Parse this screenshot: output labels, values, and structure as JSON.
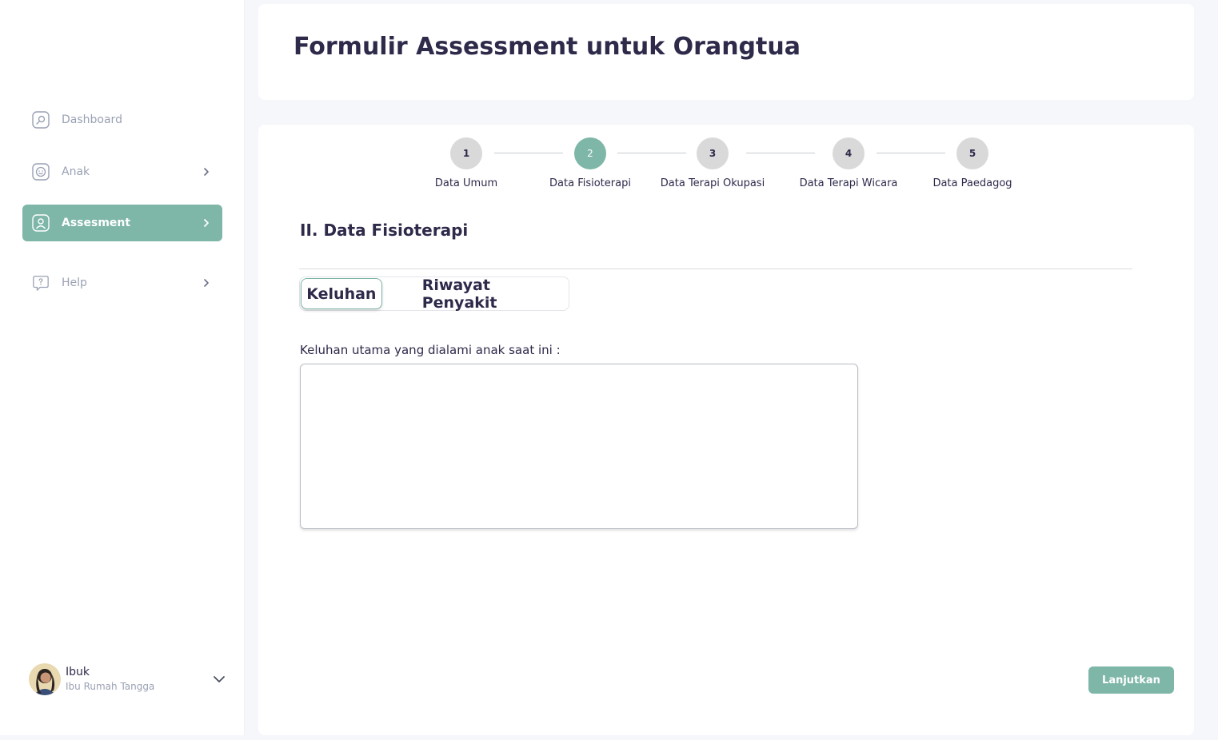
{
  "sidebar": {
    "items": [
      {
        "label": "Dashboard",
        "icon": "dashboard-icon"
      },
      {
        "label": "Anak",
        "icon": "smile-icon"
      },
      {
        "label": "Assesment",
        "icon": "user-icon"
      },
      {
        "label": "Help",
        "icon": "help-icon"
      }
    ],
    "user": {
      "name": "Ibuk",
      "role": "Ibu Rumah Tangga"
    }
  },
  "header": {
    "title": "Formulir Assessment untuk Orangtua"
  },
  "stepper": {
    "steps": [
      {
        "number": "1",
        "label": "Data Umum"
      },
      {
        "number": "2",
        "label": "Data Fisioterapi"
      },
      {
        "number": "3",
        "label": "Data Terapi Okupasi"
      },
      {
        "number": "4",
        "label": "Data Terapi Wicara"
      },
      {
        "number": "5",
        "label": "Data Paedagog"
      }
    ]
  },
  "form": {
    "section_title": "II. Data Fisioterapi",
    "tabs": [
      "Keluhan",
      "Riwayat Penyakit"
    ],
    "field_label": "Keluhan utama yang dialami anak saat ini :",
    "field_value": ""
  },
  "actions": {
    "next_label": "Lanjutkan"
  },
  "colors": {
    "accent": "#7eb6a8",
    "text": "#2d2a4a",
    "muted": "#9aa1b4"
  }
}
